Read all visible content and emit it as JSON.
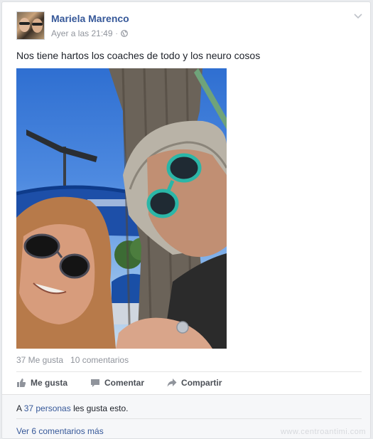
{
  "post": {
    "author": "Mariela Marenco",
    "timestamp": "Ayer a las 21:49",
    "separator": "·",
    "privacy_icon": "globe-icon",
    "text": "Nos tiene hartos los coaches de todo y los neuro cosos"
  },
  "stats": {
    "likes": "37 Me gusta",
    "comments": "10 comentarios"
  },
  "actions": {
    "like": "Me gusta",
    "comment": "Comentar",
    "share": "Compartir"
  },
  "likes_summary": {
    "prefix": "A ",
    "link": "37 personas",
    "suffix": " les gusta esto."
  },
  "more_comments": "Ver 6 comentarios más",
  "watermark": "www.centroantimi.com",
  "colors": {
    "link": "#365899",
    "muted": "#90949c",
    "footer_bg": "#f6f7f9"
  }
}
